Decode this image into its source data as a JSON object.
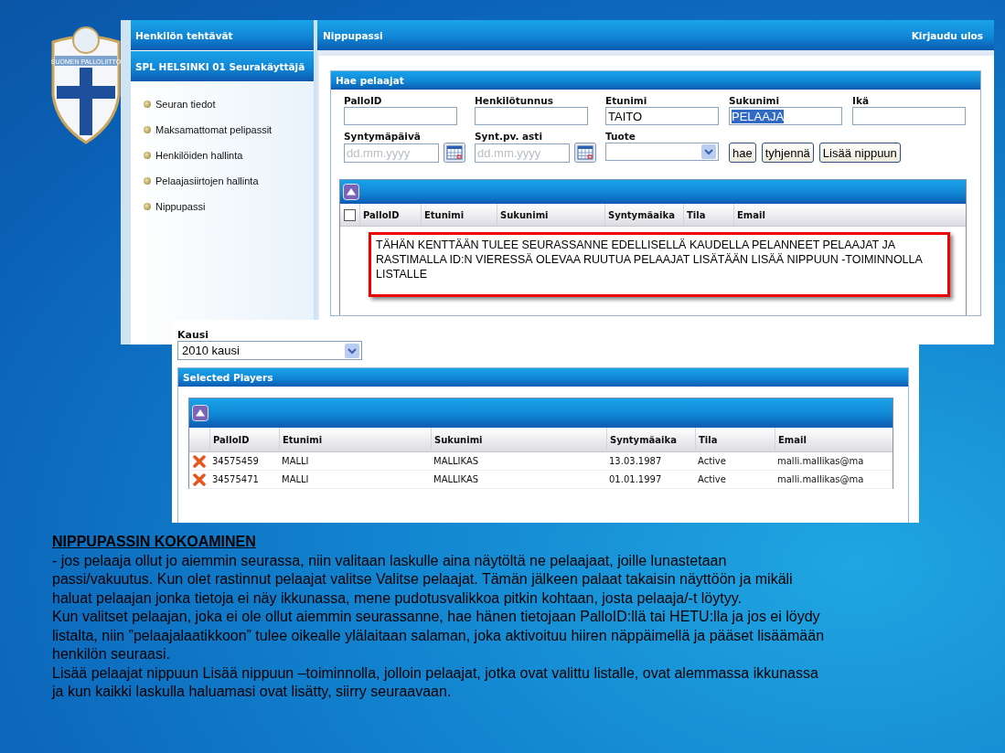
{
  "logo": {
    "text": "SUOMEN PALLOLIITTO"
  },
  "sidebar": {
    "title": "Henkilön tehtävät",
    "user": "SPL HELSINKI 01 Seurakäyttäjä",
    "items": [
      "Seuran tiedot",
      "Maksamattomat pelipassit",
      "Henkilöiden hallinta",
      "Pelaajasiirtojen hallinta",
      "Nippupassi"
    ]
  },
  "header": {
    "title": "Nippupassi",
    "logout": "Kirjaudu ulos"
  },
  "search": {
    "title": "Hae pelaajat",
    "fields": [
      {
        "label": "PalloID",
        "kind": "text"
      },
      {
        "label": "Henkilötunnus",
        "kind": "text"
      },
      {
        "label": "Etunimi",
        "kind": "text",
        "value": "TAITO",
        "highlighted": false
      },
      {
        "label": "Sukunimi",
        "kind": "text",
        "value": "PELAAJA",
        "highlighted": true
      },
      {
        "label": "Ikä",
        "kind": "text"
      },
      {
        "label": "Syntymäpäivä",
        "kind": "date",
        "placeholder": "dd.mm.yyyy"
      },
      {
        "label": "Synt.pv. asti",
        "kind": "date",
        "placeholder": "dd.mm.yyyy"
      },
      {
        "label": "Tuote",
        "kind": "select"
      }
    ],
    "buttons": [
      "hae",
      "tyhjennä",
      "Lisää nippuun"
    ]
  },
  "results": {
    "all_checked": false,
    "columns": [
      "PalloID",
      "Etunimi",
      "Sukunimi",
      "Syntymäaika",
      "Tila",
      "Email"
    ],
    "note": "TÄHÄN KENTTÄÄN TULEE SEURASSANNE EDELLISELLÄ KAUDELLA PELANNEET PELAAJAT JA RASTIMALLA ID:N VIERESSÄ OLEVAA RUUTUA PELAAJAT LISÄTÄÄN LISÄÄ NIPPUUN -TOIMINNOLLA LISTALLE"
  },
  "season": {
    "label": "Kausi",
    "value": "2010 kausi"
  },
  "selected_players": {
    "title": "Selected Players",
    "columns": [
      "PalloID",
      "Etunimi",
      "Sukunimi",
      "Syntymäaika",
      "Tila",
      "Email"
    ],
    "rows": [
      {
        "cells": [
          "34575459",
          "MALLI",
          "MALLIKAS",
          "13.03.1987",
          "Active",
          "malli.mallikas@ma"
        ]
      },
      {
        "cells": [
          "34575471",
          "MALLI",
          "MALLIKAS",
          "01.01.1997",
          "Active",
          "malli.mallikas@ma"
        ]
      }
    ]
  },
  "instructions": {
    "heading": "NIPPUPASSIN KOKOAMINEN",
    "paragraphs": [
      "- jos pelaaja ollut jo aiemmin seurassa, niin valitaan laskulle aina näytöltä ne pelaajaat, joille lunastetaan passi/vakuutus. Kun olet rastinnut pelaajat valitse Valitse pelaajat. Tämän jälkeen palaat takaisin näyttöön ja mikäli haluat pelaajan jonka tietoja ei näy ikkunassa, mene pudotusvalikkoa pitkin kohtaan, josta pelaaja/-t löytyy.",
      "Kun valitset pelaajan, joka ei ole ollut aiemmin seurassanne, hae hänen tietojaan PalloID:llä tai HETU:lla ja jos ei löydy  listalta, niin ”pelaajalaatikkoon” tulee oikealle ylälaitaan salaman, joka aktivoituu hiiren näppäimellä ja pääset lisäämään henkilön seuraasi.",
      "Lisää pelaajat nippuun Lisää nippuun –toiminnolla, jolloin pelaajat, jotka ovat valittu listalle, ovat alemmassa ikkunassa ja kun kaikki laskulla haluamasi ovat lisätty, siirry seuraavaan."
    ]
  }
}
